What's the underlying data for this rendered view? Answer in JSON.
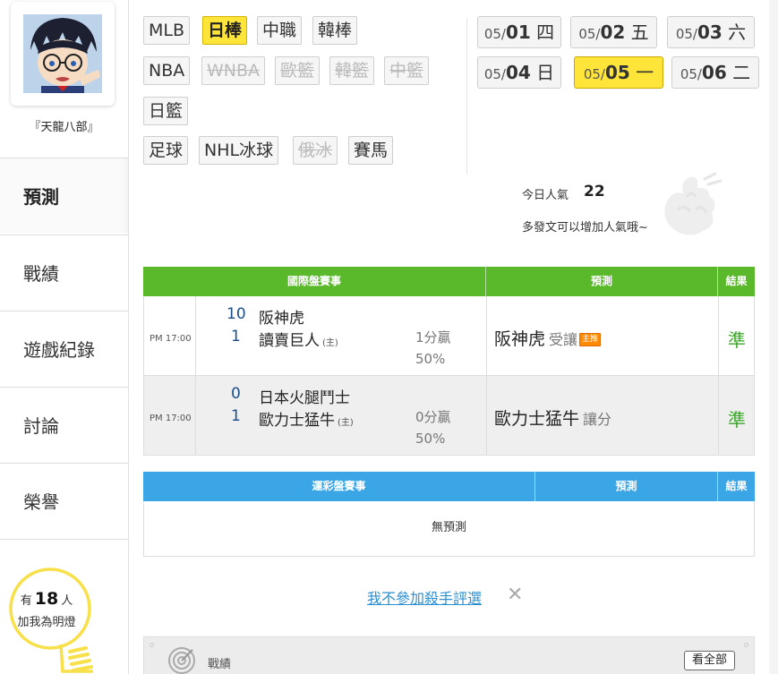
{
  "user": {
    "name": "『天龍八部』"
  },
  "sidebar": {
    "items": [
      {
        "label": "預測",
        "active": true
      },
      {
        "label": "戰績"
      },
      {
        "label": "遊戲紀錄"
      },
      {
        "label": "討論"
      },
      {
        "label": "榮譽"
      }
    ],
    "fans": {
      "prefix": "有",
      "count": "18",
      "suffix": "人",
      "line2": "加我為明燈"
    }
  },
  "sport_tags": [
    {
      "label": "MLB"
    },
    {
      "label": "日棒",
      "active": true
    },
    {
      "label": "中職"
    },
    {
      "label": "韓棒"
    },
    {
      "label": "NBA"
    },
    {
      "label": "WNBA",
      "disabled": true
    },
    {
      "label": "歐籃",
      "disabled": true
    },
    {
      "label": "韓籃",
      "disabled": true
    },
    {
      "label": "中籃",
      "disabled": true
    },
    {
      "label": "日籃"
    },
    {
      "label": "足球"
    },
    {
      "label": "NHL冰球"
    },
    {
      "label": "俄冰",
      "disabled": true
    },
    {
      "label": "賽馬"
    }
  ],
  "dates": [
    {
      "md": "05/",
      "dd": "01",
      "wd": "四"
    },
    {
      "md": "05/",
      "dd": "02",
      "wd": "五"
    },
    {
      "md": "05/",
      "dd": "03",
      "wd": "六"
    },
    {
      "md": "05/",
      "dd": "04",
      "wd": "日"
    },
    {
      "md": "05/",
      "dd": "05",
      "wd": "一",
      "active": true
    },
    {
      "md": "05/",
      "dd": "06",
      "wd": "二"
    }
  ],
  "popularity": {
    "label": "今日人氣",
    "value": "22",
    "hint": "多發文可以增加人氣哦~"
  },
  "intl_table": {
    "headers": {
      "event": "國際盤賽事",
      "prediction": "預測",
      "result": "結果"
    },
    "rows": [
      {
        "time": "PM 17:00",
        "score1": "10",
        "team1": "阪神虎",
        "score2": "1",
        "team2": "讀賣巨人",
        "home": "(主)",
        "handicap": "1分贏",
        "pct": "50%",
        "pick": "阪神虎",
        "pick_type": "受讓",
        "badge": "主推",
        "result": "準"
      },
      {
        "time": "PM 17:00",
        "score1": "0",
        "team1": "日本火腿鬥士",
        "score2": "1",
        "team2": "歐力士猛牛",
        "home": "(主)",
        "handicap": "0分贏",
        "pct": "50%",
        "pick": "歐力士猛牛",
        "pick_type": "讓分",
        "badge": "",
        "result": "準"
      }
    ]
  },
  "lottery_table": {
    "headers": {
      "event": "運彩盤賽事",
      "prediction": "預測",
      "result": "結果"
    },
    "empty": "無預測"
  },
  "optout": {
    "label": "我不參加殺手評選",
    "close": "✕"
  },
  "record": {
    "label": "戰績",
    "view_all": "看全部"
  },
  "colors": {
    "accent_yellow": "#ffe43a",
    "intl_header": "#5ab82b",
    "lottery_header": "#3aa6e6",
    "result_green": "#3aa628",
    "link_blue": "#2a8fd1"
  }
}
